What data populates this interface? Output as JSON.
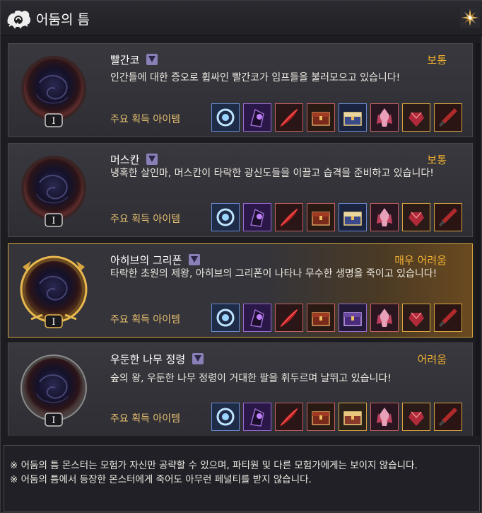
{
  "title": "어둠의 틈",
  "items_label": "주요 획득 아이템",
  "rank_numeral": "I",
  "cards": [
    {
      "name": "빨간코",
      "difficulty": "보통",
      "description": "인간들에 대한 증오로 휩싸인 빨간코가 임프들을 불러모으고 있습니다!"
    },
    {
      "name": "머스칸",
      "difficulty": "보통",
      "description": "냉혹한 살인마, 머스칸이 타락한 광신도들을 이끌고 습격을 준비하고 있습니다!"
    },
    {
      "name": "아히브의 그리폰",
      "difficulty": "매우 어려움",
      "description": "타락한 초원의 제왕, 아히브의 그리폰이 나타나 무수한 생명을 죽이고 있습니다!"
    },
    {
      "name": "우둔한 나무 정령",
      "difficulty": "어려움",
      "description": "숲의 왕, 우둔한 나무 정령이 거대한 팔을 휘두르며 날뛰고 있습니다!"
    }
  ],
  "item_icons": [
    "orb-ring-icon",
    "dark-crystal-icon",
    "red-feather-icon",
    "treasure-chest-icon",
    "blue-chest-icon",
    "red-crystal-icon",
    "red-gem-icon",
    "dagger-icon"
  ],
  "footer": {
    "line1": "※ 어둠의 틈 몬스터는 모험가 자신만 공략할 수 있으며, 파티원 및 다른 모험가에게는 보이지 않습니다.",
    "line2": "※ 어둠의 틈에서 등장한 몬스터에게 죽어도 아무런 페널티를 받지 않습니다."
  },
  "colors": {
    "difficulty": "#f0b030",
    "selected_border": "#d8a440"
  }
}
